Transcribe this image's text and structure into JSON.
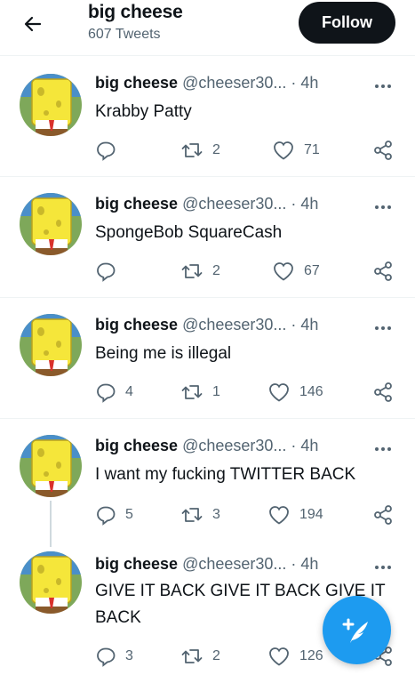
{
  "header": {
    "name": "big cheese",
    "tweet_count": "607 Tweets",
    "follow_label": "Follow"
  },
  "tweets": [
    {
      "name": "big cheese",
      "handle": "@cheeser30...",
      "time": "· 4h",
      "text": "Krabby Patty",
      "replies": "",
      "retweets": "2",
      "likes": "71"
    },
    {
      "name": "big cheese",
      "handle": "@cheeser30...",
      "time": "· 4h",
      "text": "SpongeBob SquareCash",
      "replies": "",
      "retweets": "2",
      "likes": "67"
    },
    {
      "name": "big cheese",
      "handle": "@cheeser30...",
      "time": "· 4h",
      "text": "Being me is illegal",
      "replies": "4",
      "retweets": "1",
      "likes": "146"
    },
    {
      "name": "big cheese",
      "handle": "@cheeser30...",
      "time": "· 4h",
      "text": "I want my fucking TWITTER BACK",
      "replies": "5",
      "retweets": "3",
      "likes": "194"
    },
    {
      "name": "big cheese",
      "handle": "@cheeser30...",
      "time": "· 4h",
      "text": "GIVE IT BACK GIVE IT BACK GIVE IT BACK",
      "replies": "3",
      "retweets": "2",
      "likes": "126"
    }
  ],
  "icons": {
    "back": "back-arrow-icon",
    "more": "more-dots-icon",
    "reply": "reply-icon",
    "retweet": "retweet-icon",
    "like": "heart-icon",
    "share": "share-icon",
    "compose": "compose-tweet-icon"
  },
  "colors": {
    "accent": "#1d9bf0",
    "text": "#0f1419",
    "secondary": "#536471"
  }
}
